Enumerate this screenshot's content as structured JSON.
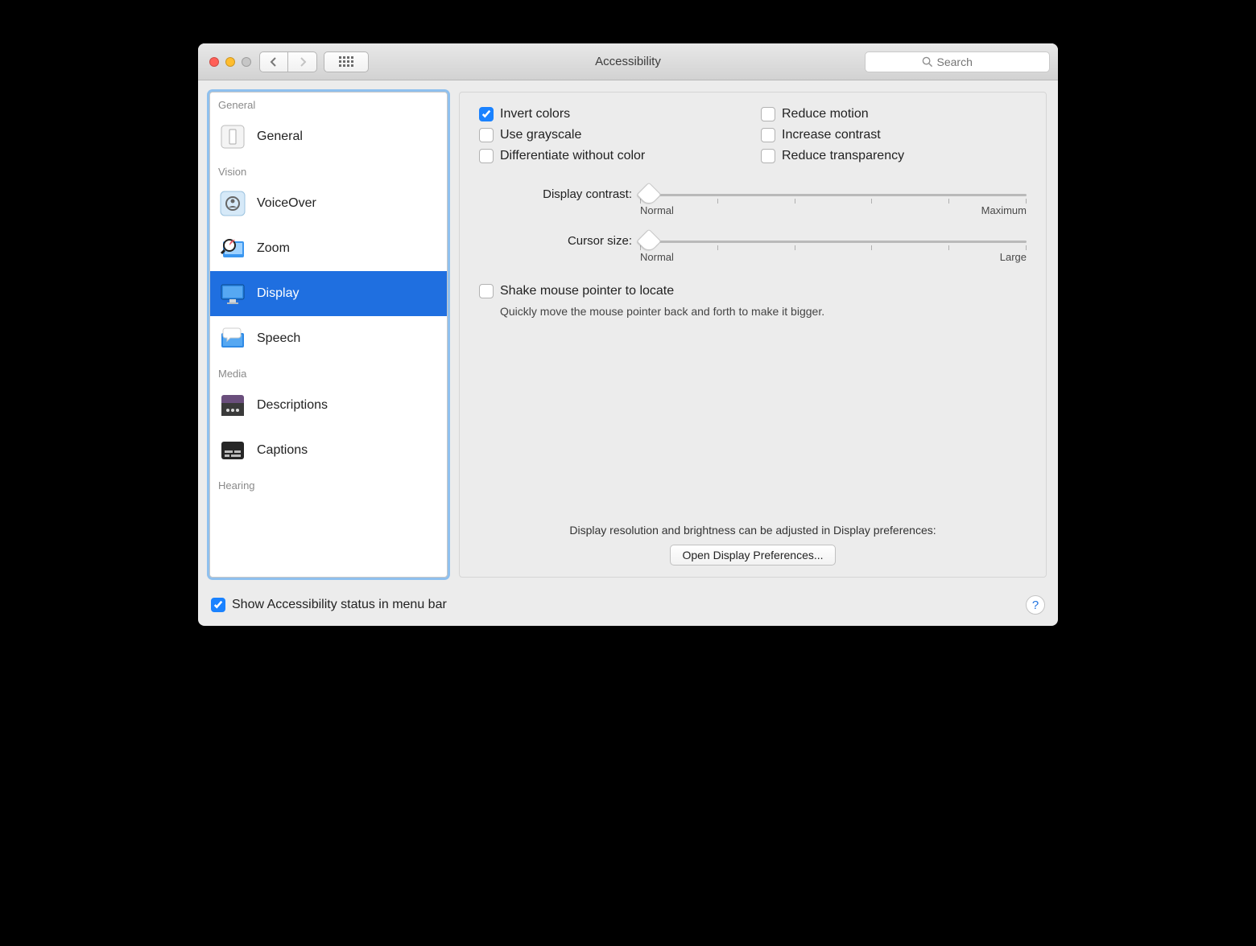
{
  "window_title": "Accessibility",
  "search": {
    "placeholder": "Search"
  },
  "sidebar": {
    "sections": [
      {
        "label": "General",
        "items": [
          {
            "id": "general",
            "label": "General"
          }
        ]
      },
      {
        "label": "Vision",
        "items": [
          {
            "id": "voiceover",
            "label": "VoiceOver"
          },
          {
            "id": "zoom",
            "label": "Zoom"
          },
          {
            "id": "display",
            "label": "Display",
            "selected": true
          },
          {
            "id": "speech",
            "label": "Speech"
          }
        ]
      },
      {
        "label": "Media",
        "items": [
          {
            "id": "descriptions",
            "label": "Descriptions"
          },
          {
            "id": "captions",
            "label": "Captions"
          }
        ]
      },
      {
        "label": "Hearing",
        "items": []
      }
    ]
  },
  "checkboxes": {
    "invert_colors": {
      "label": "Invert colors",
      "checked": true
    },
    "use_grayscale": {
      "label": "Use grayscale",
      "checked": false
    },
    "differentiate": {
      "label": "Differentiate without color",
      "checked": false
    },
    "reduce_motion": {
      "label": "Reduce motion",
      "checked": false
    },
    "increase_contrast": {
      "label": "Increase contrast",
      "checked": false
    },
    "reduce_transparency": {
      "label": "Reduce transparency",
      "checked": false
    },
    "shake_locate": {
      "label": "Shake mouse pointer to locate",
      "checked": false,
      "description": "Quickly move the mouse pointer back and forth to make it bigger."
    }
  },
  "sliders": {
    "display_contrast": {
      "label": "Display contrast:",
      "min_label": "Normal",
      "max_label": "Maximum",
      "value": 0
    },
    "cursor_size": {
      "label": "Cursor size:",
      "min_label": "Normal",
      "max_label": "Large",
      "value": 0
    }
  },
  "footer_note": "Display resolution and brightness can be adjusted in Display preferences:",
  "open_button": "Open Display Preferences...",
  "menubar_checkbox": {
    "label": "Show Accessibility status in menu bar",
    "checked": true
  },
  "help_tooltip": "?"
}
